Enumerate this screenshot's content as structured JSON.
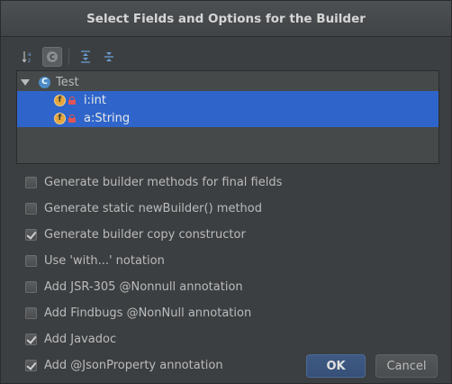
{
  "window": {
    "title": "Select Fields and Options for the Builder"
  },
  "toolbar": {
    "buttons": [
      {
        "icon": "sort-alphabetically-icon",
        "active": false
      },
      {
        "icon": "show-classes-icon",
        "glyph": "C",
        "active": true
      },
      {
        "icon": "expand-all-icon",
        "active": false
      },
      {
        "icon": "collapse-all-icon",
        "active": false
      }
    ]
  },
  "tree": {
    "root": {
      "label": "Test",
      "icon_glyph": "C",
      "expanded": true
    },
    "fields": [
      {
        "label": "i:int",
        "icon_glyph": "f",
        "selected": true
      },
      {
        "label": "a:String",
        "icon_glyph": "f",
        "selected": true
      }
    ]
  },
  "options": [
    {
      "label": "Generate builder methods for final fields",
      "checked": false
    },
    {
      "label": "Generate static newBuilder() method",
      "checked": false
    },
    {
      "label": "Generate builder copy constructor",
      "checked": true
    },
    {
      "label": "Use 'with...' notation",
      "checked": false
    },
    {
      "label": "Add JSR-305 @Nonnull annotation",
      "checked": false
    },
    {
      "label": "Add Findbugs @NonNull annotation",
      "checked": false
    },
    {
      "label": "Add Javadoc",
      "checked": true
    },
    {
      "label": "Add @JsonProperty annotation",
      "checked": true
    }
  ],
  "buttons": {
    "ok": "OK",
    "cancel": "Cancel"
  },
  "colors": {
    "accent": "#2f65ca",
    "background": "#3c3f41",
    "text": "#bbbbbb"
  }
}
